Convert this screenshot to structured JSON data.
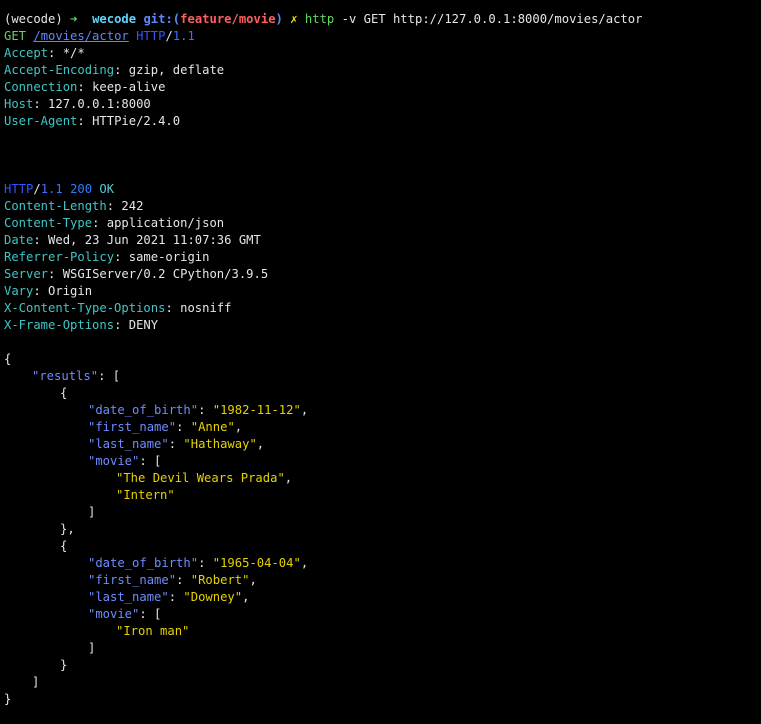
{
  "prompt": {
    "env": "(wecode)",
    "arrow": "➜",
    "dir": "wecode",
    "git_prefix": "git:(",
    "branch": "feature/movie",
    "git_suffix": ")",
    "dirty_mark": "✗",
    "command": "http",
    "args": "-v GET http://127.0.0.1:8000/movies/actor"
  },
  "request": {
    "method": "GET",
    "path": "/movies/actor",
    "proto": "HTTP",
    "slash": "/",
    "version": "1.1",
    "headers": [
      {
        "name": "Accept",
        "value": "*/*"
      },
      {
        "name": "Accept-Encoding",
        "value": "gzip, deflate"
      },
      {
        "name": "Connection",
        "value": "keep-alive"
      },
      {
        "name": "Host",
        "value": "127.0.0.1:8000"
      },
      {
        "name": "User-Agent",
        "value": "HTTPie/2.4.0"
      }
    ]
  },
  "response": {
    "proto": "HTTP",
    "slash": "/",
    "version": "1.1",
    "status": "200",
    "reason": "OK",
    "headers": [
      {
        "name": "Content-Length",
        "value": "242"
      },
      {
        "name": "Content-Type",
        "value": "application/json"
      },
      {
        "name": "Date",
        "value": "Wed, 23 Jun 2021 11:07:36 GMT"
      },
      {
        "name": "Referrer-Policy",
        "value": "same-origin"
      },
      {
        "name": "Server",
        "value": "WSGIServer/0.2 CPython/3.9.5"
      },
      {
        "name": "Vary",
        "value": "Origin"
      },
      {
        "name": "X-Content-Type-Options",
        "value": "nosniff"
      },
      {
        "name": "X-Frame-Options",
        "value": "DENY"
      }
    ]
  },
  "body": {
    "top_key": "resutls",
    "actors": [
      {
        "date_of_birth": "1982-11-12",
        "first_name": "Anne",
        "last_name": "Hathaway",
        "movie": [
          "The Devil Wears Prada",
          "Intern"
        ]
      },
      {
        "date_of_birth": "1965-04-04",
        "first_name": "Robert",
        "last_name": "Downey",
        "movie": [
          "Iron man"
        ]
      }
    ]
  },
  "colors": {
    "background": "#000000",
    "text": "#e6e6e6",
    "json_key": "#6f8cff",
    "json_string": "#e6d200",
    "header_name": "#3fc6c6",
    "branch": "#ff5f5f"
  }
}
